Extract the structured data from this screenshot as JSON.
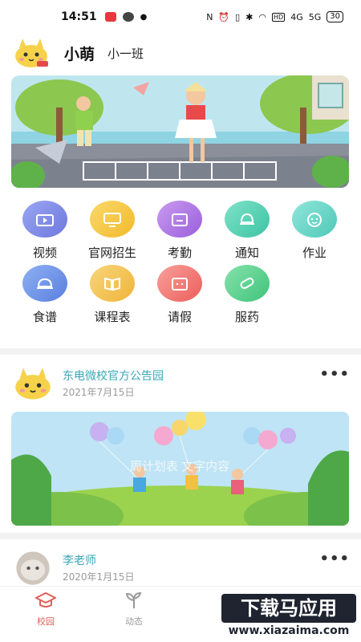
{
  "status_bar": {
    "time": "14:51",
    "network_labels": [
      "4G",
      "5G"
    ],
    "battery": "30"
  },
  "profile": {
    "name": "小萌",
    "class": "小一班"
  },
  "grid": [
    {
      "label": "视频",
      "icon": "video-icon",
      "color": "#7e8be6"
    },
    {
      "label": "官网招生",
      "icon": "monitor-icon",
      "color": "#f5c748"
    },
    {
      "label": "考勤",
      "icon": "calendar-icon",
      "color": "#b77be6"
    },
    {
      "label": "通知",
      "icon": "bell-icon",
      "color": "#5bd3b8"
    },
    {
      "label": "作业",
      "icon": "face-icon",
      "color": "#6ed7c8"
    },
    {
      "label": "食谱",
      "icon": "food-cover-icon",
      "color": "#6f95e8"
    },
    {
      "label": "课程表",
      "icon": "book-icon",
      "color": "#f4c45a"
    },
    {
      "label": "请假",
      "icon": "leave-calendar-icon",
      "color": "#f27b78"
    },
    {
      "label": "服药",
      "icon": "pill-icon",
      "color": "#5ecf8e"
    }
  ],
  "posts": [
    {
      "title": "东电微校官方公告园",
      "date": "2021年7月15日",
      "more": "•••"
    },
    {
      "title": "李老师",
      "date": "2020年1月15日",
      "more": "•••"
    }
  ],
  "post_image_caption": "周计划表    文字内容",
  "tabbar": [
    {
      "label": "校园",
      "icon": "school-cap-icon",
      "active": true
    },
    {
      "label": "动态",
      "icon": "sprout-icon",
      "active": false
    }
  ],
  "watermark": {
    "main": "下载马应用",
    "url": "www.xiazaima.com"
  },
  "colors": {
    "accent_link": "#3aa7b8",
    "tab_active": "#e0605a",
    "tab_inactive": "#9a9a9a"
  }
}
